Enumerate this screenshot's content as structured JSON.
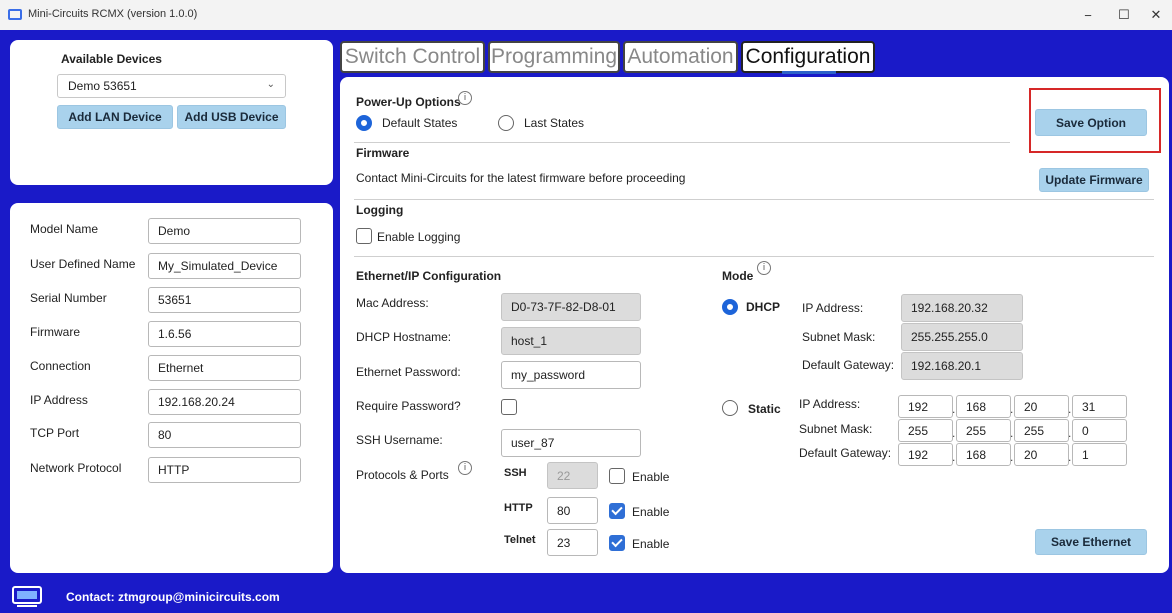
{
  "window": {
    "title": "Mini-Circuits RCMX (version 1.0.0)",
    "min": "−",
    "max": "☐",
    "close": "✕"
  },
  "devices": {
    "heading": "Available Devices",
    "selected": "Demo  53651",
    "add_lan": "Add LAN Device",
    "add_usb": "Add USB Device"
  },
  "device_info": [
    {
      "label": "Model Name",
      "value": "Demo"
    },
    {
      "label": "User Defined Name",
      "value": "My_Simulated_Device"
    },
    {
      "label": "Serial Number",
      "value": "53651"
    },
    {
      "label": "Firmware",
      "value": "1.6.56"
    },
    {
      "label": "Connection",
      "value": "Ethernet"
    },
    {
      "label": "IP Address",
      "value": "192.168.20.24"
    },
    {
      "label": "TCP Port",
      "value": "80"
    },
    {
      "label": "Network Protocol",
      "value": "HTTP"
    }
  ],
  "tabs": [
    "Switch Control",
    "Programming",
    "Automation",
    "Configuration"
  ],
  "power_up": {
    "heading": "Power-Up Options",
    "default": "Default States",
    "last": "Last States",
    "save": "Save Option"
  },
  "firmware": {
    "heading": "Firmware",
    "text": "Contact Mini-Circuits for the latest firmware before proceeding",
    "update": "Update Firmware"
  },
  "logging": {
    "heading": "Logging",
    "enable": "Enable Logging"
  },
  "ethernet": {
    "heading": "Ethernet/IP Configuration",
    "mac_label": "Mac Address:",
    "mac": "D0-73-7F-82-D8-01",
    "host_label": "DHCP Hostname:",
    "host": "host_1",
    "pwd_label": "Ethernet Password:",
    "pwd": "my_password",
    "req_label": "Require Password?",
    "ssh_user_label": "SSH Username:",
    "ssh_user": "user_87",
    "protocols_label": "Protocols & Ports",
    "protocols": [
      {
        "name": "SSH",
        "port": "22",
        "enable": "Enable",
        "checked": false,
        "disabled": true
      },
      {
        "name": "HTTP",
        "port": "80",
        "enable": "Enable",
        "checked": true,
        "disabled": false
      },
      {
        "name": "Telnet",
        "port": "23",
        "enable": "Enable",
        "checked": true,
        "disabled": false
      }
    ],
    "save": "Save Ethernet"
  },
  "mode": {
    "heading": "Mode",
    "dhcp": {
      "label": "DHCP",
      "ip_label": "IP Address:",
      "ip": "192.168.20.32",
      "mask_label": "Subnet Mask:",
      "mask": "255.255.255.0",
      "gw_label": "Default Gateway:",
      "gw": "192.168.20.1"
    },
    "static": {
      "label": "Static",
      "ip_label": "IP Address:",
      "ip": [
        "192",
        "168",
        "20",
        "31"
      ],
      "mask_label": "Subnet Mask:",
      "mask": [
        "255",
        "255",
        "255",
        "0"
      ],
      "gw_label": "Default Gateway:",
      "gw": [
        "192",
        "168",
        "20",
        "1"
      ]
    }
  },
  "footer": {
    "contact": "Contact: ztmgroup@minicircuits.com"
  },
  "colors": {
    "accent": "#2d62c9",
    "button": "#a9d2ec",
    "highlight": "#d62828",
    "background": "#1a1ac8"
  }
}
